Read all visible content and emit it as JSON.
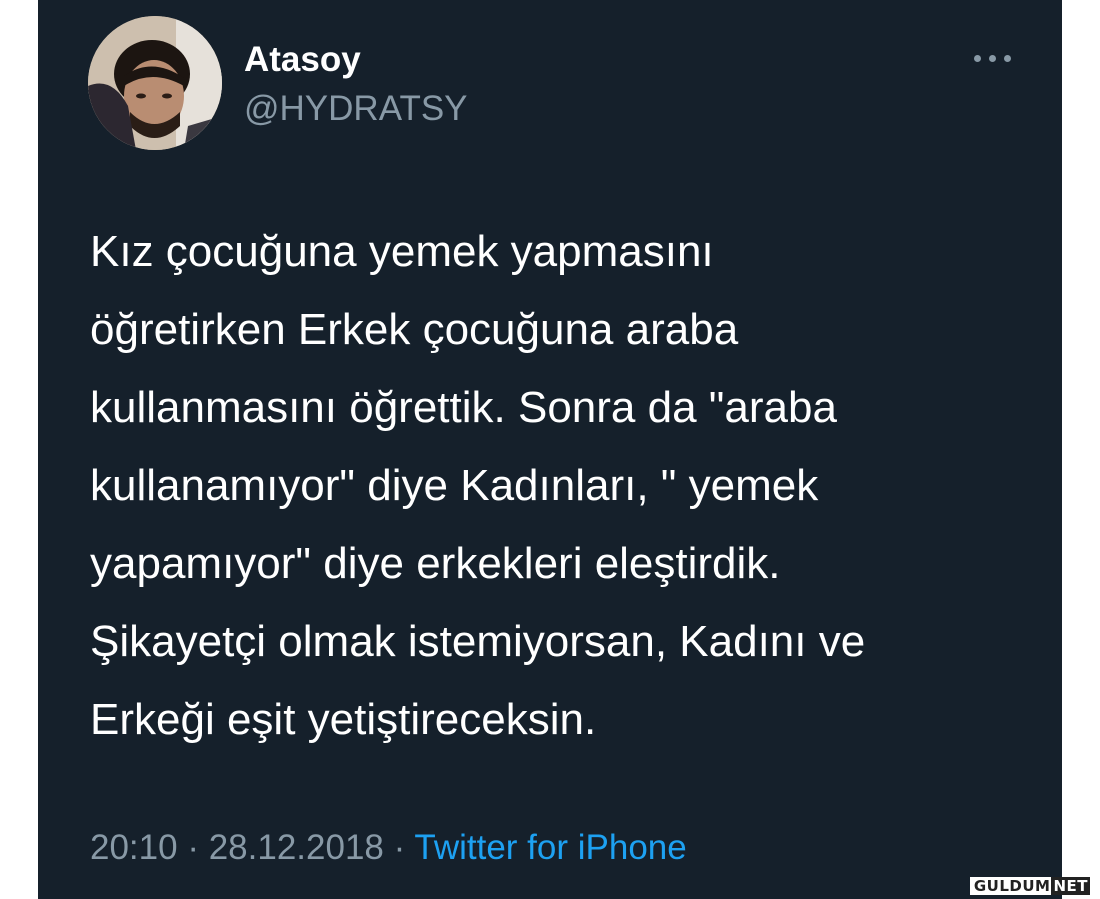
{
  "user": {
    "display_name": "Atasoy",
    "handle": "@HYDRATSY",
    "avatar_icon": "profile-photo"
  },
  "menu": {
    "more_icon": "more-horizontal-icon"
  },
  "tweet": {
    "lines": [
      "Kız çocuğuna yemek yapmasını",
      "öğretirken Erkek çocuğuna araba",
      "kullanmasını öğrettik. Sonra da \"araba",
      "kullanamıyor\" diye Kadınları, \" yemek",
      "yapamıyor\" diye erkekleri eleştirdik.",
      "Şikayetçi olmak istemiyorsan, Kadını ve",
      "Erkeği eşit yetiştireceksin."
    ],
    "time": "20:10",
    "separator": "·",
    "date": "28.12.2018",
    "source": "Twitter for iPhone"
  },
  "watermark": {
    "main": "GULDUM",
    "suffix": "NET"
  },
  "colors": {
    "background": "#15202b",
    "text": "#ffffff",
    "secondary": "#8899a6",
    "link": "#1da1f2"
  }
}
